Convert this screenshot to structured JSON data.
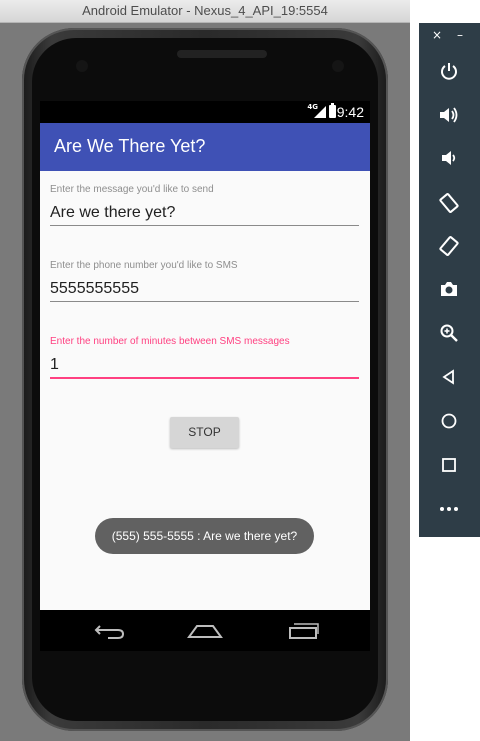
{
  "window": {
    "title": "Android Emulator - Nexus_4_API_19:5554"
  },
  "status_bar": {
    "network": "4G",
    "time": "9:42"
  },
  "app_bar": {
    "title": "Are We There Yet?"
  },
  "form": {
    "message": {
      "label": "Enter the message you'd like to send",
      "value": "Are we there yet?"
    },
    "phone": {
      "label": "Enter the phone number you'd like to SMS",
      "value": "5555555555"
    },
    "minutes": {
      "label": "Enter the number of minutes between SMS messages",
      "value": "1"
    }
  },
  "stop_button": {
    "label": "STOP"
  },
  "toast": {
    "text": "(555) 555-5555 : Are we there yet?"
  },
  "navigation": {
    "icons": [
      "back-icon",
      "home-icon",
      "recents-icon"
    ]
  },
  "emulator_toolbar": {
    "close_glyph": "×",
    "minimize_glyph": "–",
    "buttons": [
      "power-icon",
      "volume-up-icon",
      "volume-down-icon",
      "rotate-left-icon",
      "rotate-right-icon",
      "camera-icon",
      "zoom-icon",
      "back-icon",
      "home-icon",
      "overview-icon",
      "more-icon"
    ]
  },
  "colors": {
    "app_bar": "#3f51b5",
    "accent": "#ff4081",
    "toast_bg": "#616161",
    "toolbar_bg": "#2e3d47"
  }
}
